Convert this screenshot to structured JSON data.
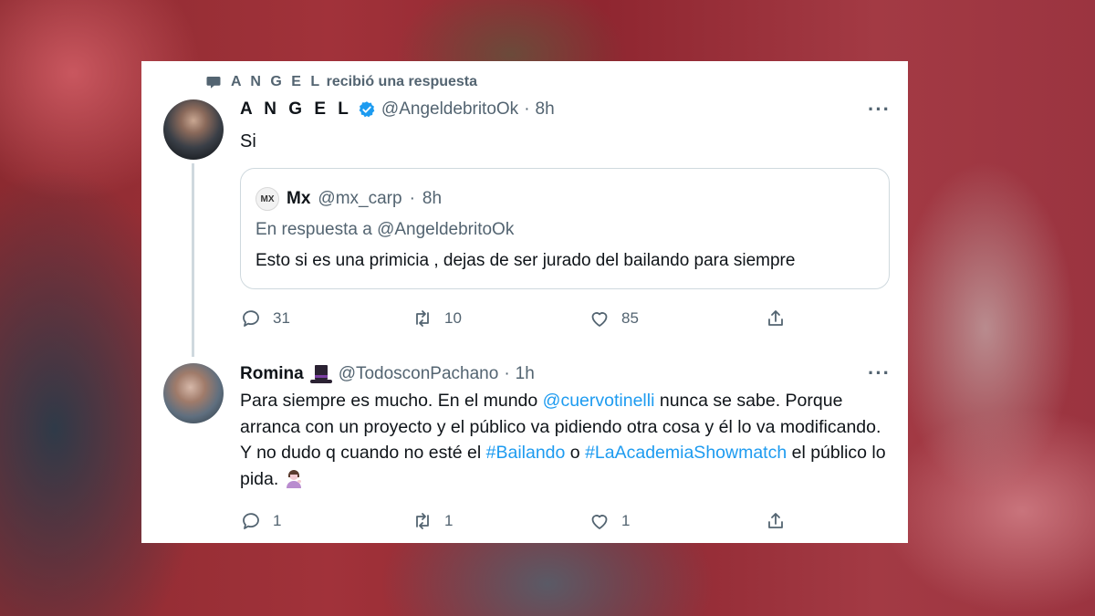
{
  "context": {
    "name": "A N G E L",
    "text": "recibió una respuesta"
  },
  "tweet1": {
    "name": "A N G E L",
    "handle": "@AngeldebritoOk",
    "dot": "·",
    "time": "8h",
    "text": "Si",
    "quote": {
      "avatar_text": "MX",
      "name": "Mx",
      "handle": "@mx_carp",
      "dot": "·",
      "time": "8h",
      "reply_to": "En respuesta a @AngeldebritoOk",
      "text": "Esto si es una primicia , dejas de ser jurado del bailando para siempre"
    },
    "actions": {
      "replies": "31",
      "retweets": "10",
      "likes": "85"
    }
  },
  "tweet2": {
    "name": "Romina",
    "handle": "@TodosconPachano",
    "dot": "·",
    "time": "1h",
    "text_part1": "Para siempre es mucho. En el mundo ",
    "mention": "@cuervotinelli",
    "text_part2": " nunca se sabe. Porque arranca con un proyecto y el público va pidiendo otra cosa y él lo va modificando. Y no dudo q cuando no esté el ",
    "hashtag1": "#Bailando",
    "text_part3": " o ",
    "hashtag2": "#LaAcademiaShowmatch",
    "text_part4": " el público lo pida. ",
    "actions": {
      "replies": "1",
      "retweets": "1",
      "likes": "1"
    }
  },
  "colors": {
    "link": "#1d9bf0",
    "verified": "#1d9bf0",
    "secondary_text": "#536471"
  },
  "icons": [
    "speech-bubble-icon",
    "verified-badge-icon",
    "more-icon",
    "reply-icon",
    "retweet-icon",
    "like-icon",
    "share-icon",
    "top-hat-emoji",
    "woman-tipping-hand-emoji"
  ]
}
